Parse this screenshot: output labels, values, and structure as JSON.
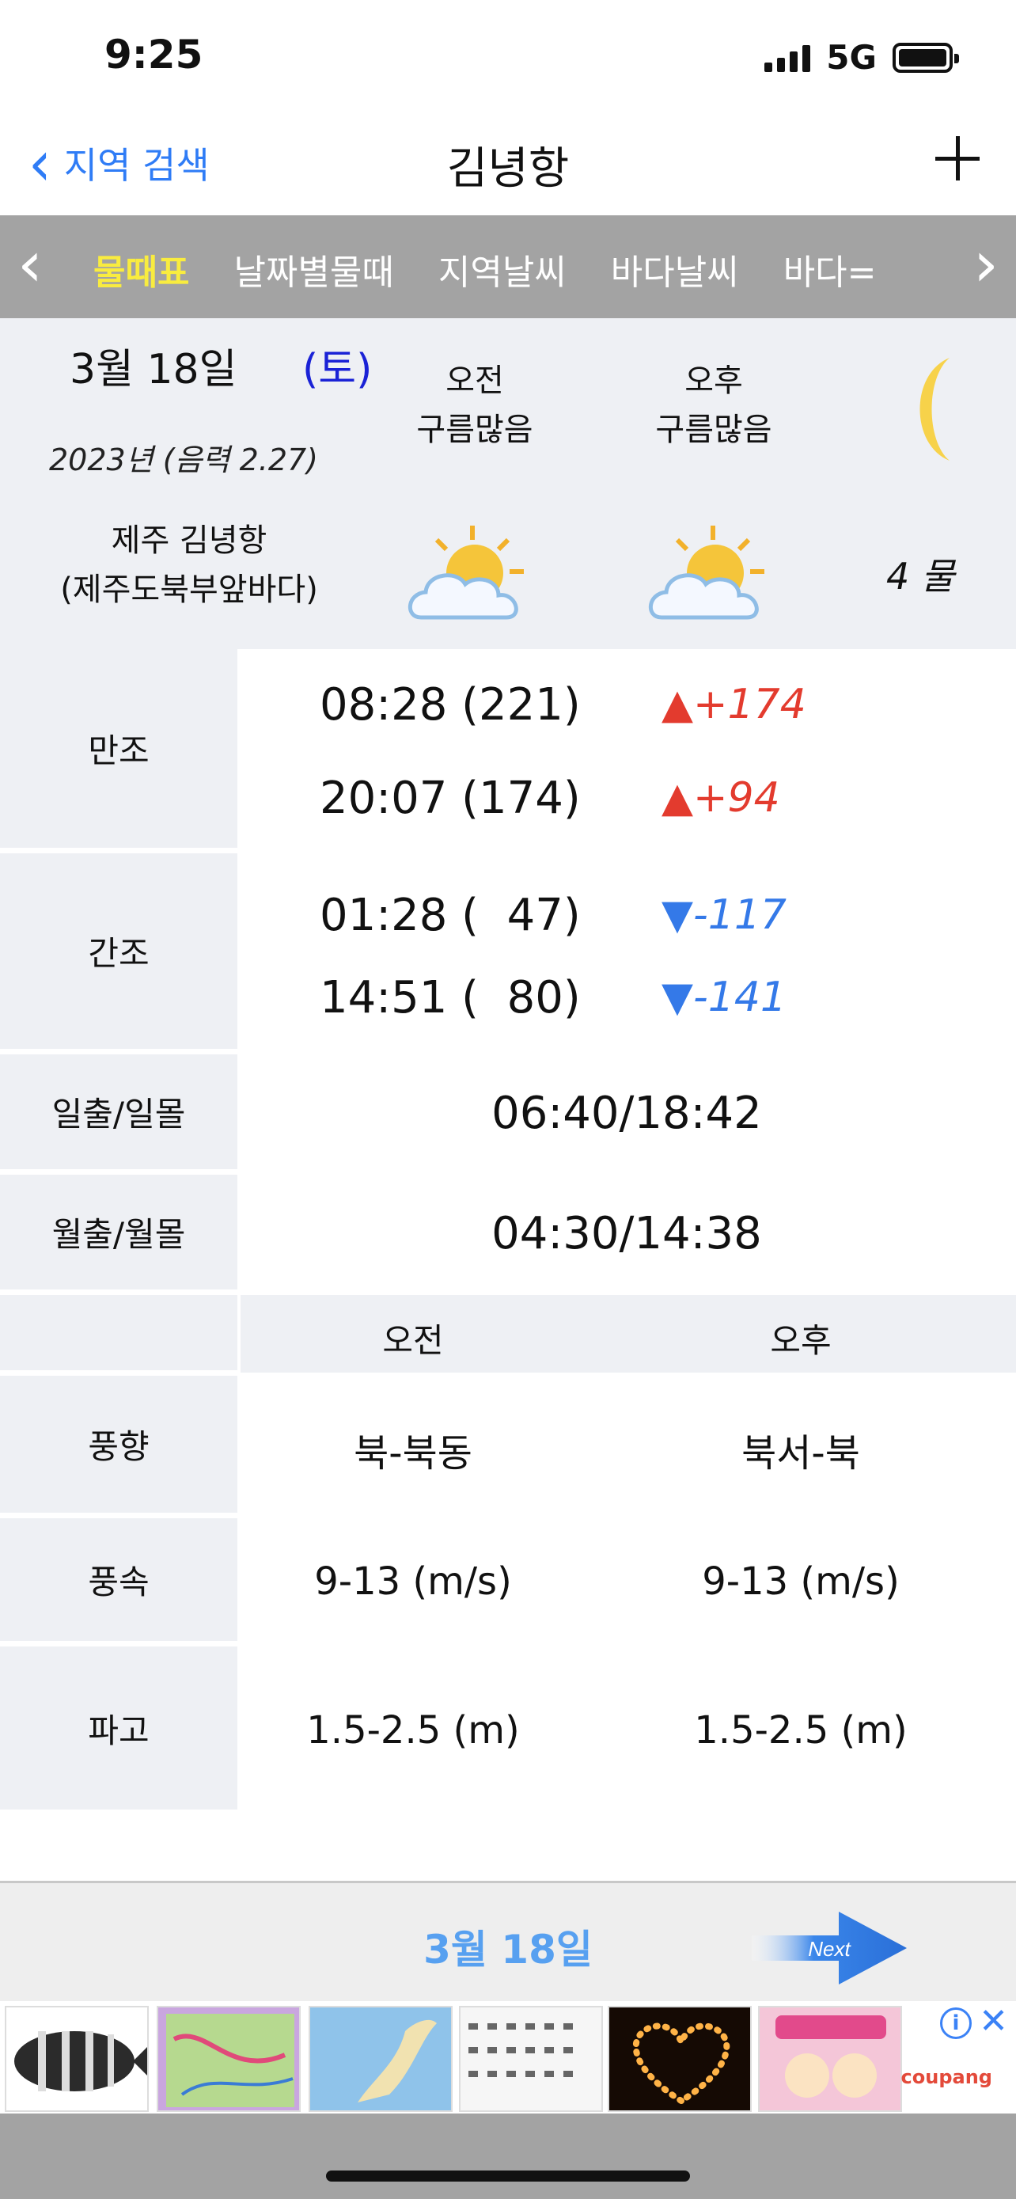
{
  "status_bar": {
    "time": "9:25",
    "network": "5G"
  },
  "nav": {
    "back_label": "지역 검색",
    "title": "김녕항",
    "add_icon": "plus-icon"
  },
  "tabs": [
    {
      "label": "물때표",
      "active": true
    },
    {
      "label": "날짜별물때",
      "active": false
    },
    {
      "label": "지역날씨",
      "active": false
    },
    {
      "label": "바다날씨",
      "active": false
    },
    {
      "label": "바다=",
      "active": false
    }
  ],
  "info": {
    "date": "3월 18일",
    "day_of_week": "(토)",
    "year_lunar": "2023년 (음력 2.27)",
    "am_label": "오전",
    "am_weather": "구름많음",
    "pm_label": "오후",
    "pm_weather": "구름많음",
    "location_line1": "제주 김녕항",
    "location_line2": "(제주도북부앞바다)",
    "tide_day": "4 물",
    "weather_icon": "partly-cloudy-icon",
    "moon_icon": "crescent-moon-icon"
  },
  "tide_table": {
    "high_label": "만조",
    "high": [
      {
        "time": "08:28 (221)",
        "diff": "▲+174"
      },
      {
        "time": "20:07 (174)",
        "diff": "▲+94"
      }
    ],
    "low_label": "간조",
    "low": [
      {
        "time": "01:28 (  47)",
        "diff": "▼-117"
      },
      {
        "time": "14:51 (  80)",
        "diff": "▼-141"
      }
    ],
    "sun_label": "일출/일몰",
    "sun_value": "06:40/18:42",
    "moon_label": "월출/월몰",
    "moon_value": "04:30/14:38"
  },
  "marine": {
    "am_header": "오전",
    "pm_header": "오후",
    "wind_dir_label": "풍향",
    "wind_dir_am": "북-북동",
    "wind_dir_pm": "북서-북",
    "wind_speed_label": "풍속",
    "wind_speed_am": "9-13 (m/s)",
    "wind_speed_pm": "9-13 (m/s)",
    "wave_label": "파고",
    "wave_am": "1.5-2.5 (m)",
    "wave_pm": "1.5-2.5 (m)"
  },
  "bottom": {
    "date": "3월 18일",
    "next_label": "Next"
  },
  "ad": {
    "brand": "coupang",
    "info_icon": "i"
  },
  "colors": {
    "accent": "#2f7cf6",
    "tab_bg": "#a3a3a3",
    "active_tab": "#f9ec3f",
    "up": "#e33b2e",
    "down": "#3479e8",
    "panel": "#eef0f4"
  }
}
